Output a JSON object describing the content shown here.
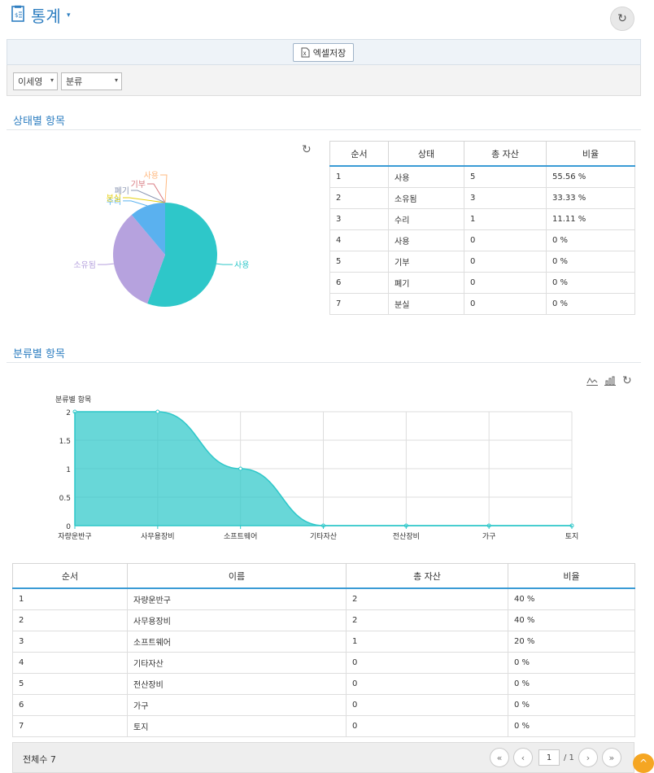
{
  "header": {
    "title": "통계",
    "caret": "▾",
    "refresh_icon": "↻"
  },
  "toolbar": {
    "excel_label": "엑셀저장",
    "excel_icon": "X"
  },
  "filters": {
    "user_select": "이세영",
    "category_select": "분류",
    "arrow": "▾"
  },
  "status_section": {
    "title": "상태별 항목",
    "refresh_icon": "↻",
    "columns": [
      "순서",
      "상태",
      "총 자산",
      "비율"
    ],
    "rows": [
      [
        "1",
        "사용",
        "5",
        "55.56 %"
      ],
      [
        "2",
        "소유됨",
        "3",
        "33.33 %"
      ],
      [
        "3",
        "수리",
        "1",
        "11.11 %"
      ],
      [
        "4",
        "사용",
        "0",
        "0 %"
      ],
      [
        "5",
        "기부",
        "0",
        "0 %"
      ],
      [
        "6",
        "폐기",
        "0",
        "0 %"
      ],
      [
        "7",
        "분실",
        "0",
        "0 %"
      ]
    ]
  },
  "category_section": {
    "title": "분류별 항목",
    "icons": [
      "line-chart-icon",
      "bar-chart-icon",
      "refresh-icon"
    ],
    "columns": [
      "순서",
      "이름",
      "총 자산",
      "비율"
    ],
    "rows": [
      [
        "1",
        "자량운반구",
        "2",
        "40 %"
      ],
      [
        "2",
        "사무용장비",
        "2",
        "40 %"
      ],
      [
        "3",
        "소프트웨어",
        "1",
        "20 %"
      ],
      [
        "4",
        "기타자산",
        "0",
        "0 %"
      ],
      [
        "5",
        "전산장비",
        "0",
        "0 %"
      ],
      [
        "6",
        "가구",
        "0",
        "0 %"
      ],
      [
        "7",
        "토지",
        "0",
        "0 %"
      ]
    ]
  },
  "chart_data": [
    {
      "type": "pie",
      "categories": [
        "사용",
        "소유됨",
        "수리",
        "분실",
        "폐기",
        "기부",
        "사용"
      ],
      "values": [
        5,
        3,
        1,
        0,
        0,
        0,
        0
      ],
      "colors": [
        "#2ec7c9",
        "#b6a2de",
        "#5ab1ef",
        "#ffb980",
        "#d87a80",
        "#8d98b3",
        "#e5cf0d"
      ],
      "label_colors": [
        "#2ec7c9",
        "#b6a2de",
        "#5ab1ef",
        "#e5cf0d",
        "#8d98b3",
        "#d87a80",
        "#ffb980"
      ],
      "title": "",
      "legend": "none"
    },
    {
      "type": "area",
      "title": "분류별 항목",
      "categories": [
        "자량운반구",
        "사무용장비",
        "소프트웨어",
        "기타자산",
        "전산장비",
        "가구",
        "토지"
      ],
      "values": [
        2,
        2,
        1,
        0,
        0,
        0,
        0
      ],
      "ylim": [
        0,
        2
      ],
      "yticks": [
        "0",
        "0.5",
        "1",
        "1.5",
        "2"
      ],
      "grid": true,
      "color": "#2ec7c9",
      "xlabel": "",
      "ylabel": ""
    }
  ],
  "footer": {
    "total_label": "전체수 7",
    "page_current": "1",
    "page_total": "/ 1",
    "first": "«",
    "prev": "‹",
    "next": "›",
    "last": "»",
    "scroll_top": "^"
  }
}
